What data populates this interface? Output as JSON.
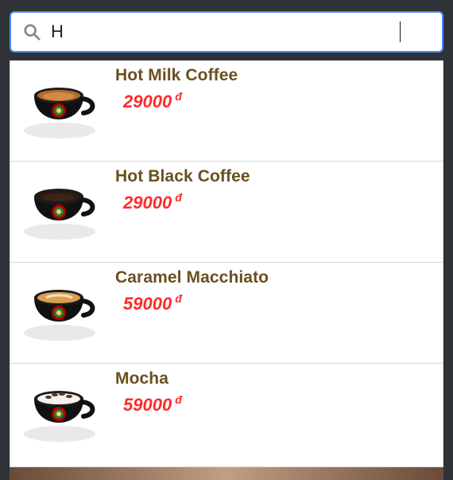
{
  "search": {
    "value": "H",
    "placeholder": ""
  },
  "results": [
    {
      "name": "Hot Milk Coffee",
      "price": "29000",
      "currency": "đ",
      "image": "coffee-cup-hot-milk"
    },
    {
      "name": "Hot Black Coffee",
      "price": "29000",
      "currency": "đ",
      "image": "coffee-cup-black"
    },
    {
      "name": "Caramel Macchiato",
      "price": "59000",
      "currency": "đ",
      "image": "coffee-cup-caramel-macchiato"
    },
    {
      "name": "Mocha",
      "price": "59000",
      "currency": "đ",
      "image": "coffee-cup-mocha"
    }
  ],
  "colors": {
    "accent": "#4c8cf7",
    "name_text": "#6b4f1f",
    "price_text": "#ff2a2a"
  }
}
